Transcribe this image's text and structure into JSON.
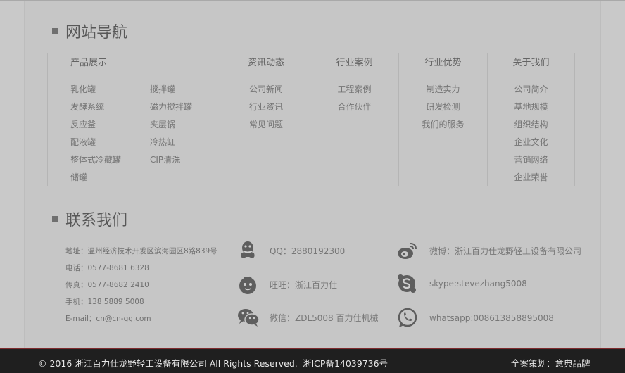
{
  "nav_title": "网站导航",
  "columns": [
    {
      "head": "产品展示",
      "items": [
        "乳化罐",
        "搅拌罐",
        "发酵系统",
        "磁力搅拌罐",
        "反应釜",
        "夹层锅",
        "配液罐",
        "冷热缸",
        "整体式冷藏罐",
        "CIP清洗",
        "储罐"
      ]
    },
    {
      "head": "资讯动态",
      "items": [
        "公司新闻",
        "行业资讯",
        "常见问题"
      ]
    },
    {
      "head": "行业案例",
      "items": [
        "工程案例",
        "合作伙伴"
      ]
    },
    {
      "head": "行业优势",
      "items": [
        "制造实力",
        "研发检测",
        "我们的服务"
      ]
    },
    {
      "head": "关于我们",
      "items": [
        "公司简介",
        "基地规模",
        "组织结构",
        "企业文化",
        "营销网络",
        "企业荣誉"
      ]
    }
  ],
  "contact_title": "联系我们",
  "address": [
    "地址：温州经济技术开发区滨海园区8路839号",
    "电话：0577-8681 6328",
    "传真：0577-8682 2410",
    "手机：138 5889 5008",
    "E-mail：cn@cn-gg.com"
  ],
  "contacts": {
    "qq": {
      "text": "QQ：2880192300",
      "icon": "qq-icon"
    },
    "wangwang": {
      "text": "旺旺：浙江百力仕",
      "icon": "wangwang-icon"
    },
    "wechat": {
      "text": "微信：ZDL5008 百力仕机械",
      "icon": "wechat-icon"
    },
    "weibo": {
      "text": "微博：浙江百力仕龙野轻工设备有限公司",
      "icon": "weibo-icon"
    },
    "skype": {
      "text": "skype:stevezhang5008",
      "icon": "skype-icon"
    },
    "whatsapp": {
      "text": "whatsapp:008613858895008",
      "icon": "whatsapp-icon"
    }
  },
  "footer": {
    "copyright": "© 2016 浙江百力仕龙野轻工设备有限公司 All Rights Reserved.",
    "icp": "浙ICP备14039736号",
    "design": "全案策划：意典品牌"
  },
  "colors": {
    "footer_bg": "#1f1f1f",
    "footer_accent": "#7d2a2d",
    "page_bg": "#c8c8c8"
  }
}
